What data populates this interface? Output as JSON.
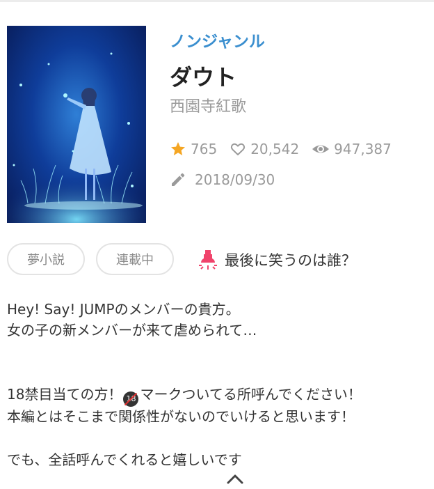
{
  "story": {
    "genre": "ノンジャンル",
    "title": "ダウト",
    "author": "西園寺紅歌",
    "stars": "765",
    "likes": "20,542",
    "views": "947,387",
    "date": "2018/09/30"
  },
  "tags": [
    "夢小説",
    "連載中"
  ],
  "catchphrase": "最後に笑うのは誰？",
  "description": {
    "line1": "Hey! Say! JUMPのメンバーの貴方。",
    "line2": "女の子の新メンバーが来て虐められて…",
    "line3_pre": "18禁目当ての方！",
    "r18_badge": "18",
    "line3_post": "マークついてる所呼んでください！",
    "line4": "本編とはそこまで関係性がないのでいけると思います！",
    "line5": "でも、全話呼んでくれると嬉しいです"
  },
  "colors": {
    "genre": "#3b8fcf",
    "star": "#f5a623",
    "bulb": "#f0436b",
    "muted": "#9a9a9a"
  },
  "icons": [
    "star-icon",
    "heart-icon",
    "eye-icon",
    "pencil-icon",
    "lightbulb-icon",
    "chevron-up-icon"
  ]
}
